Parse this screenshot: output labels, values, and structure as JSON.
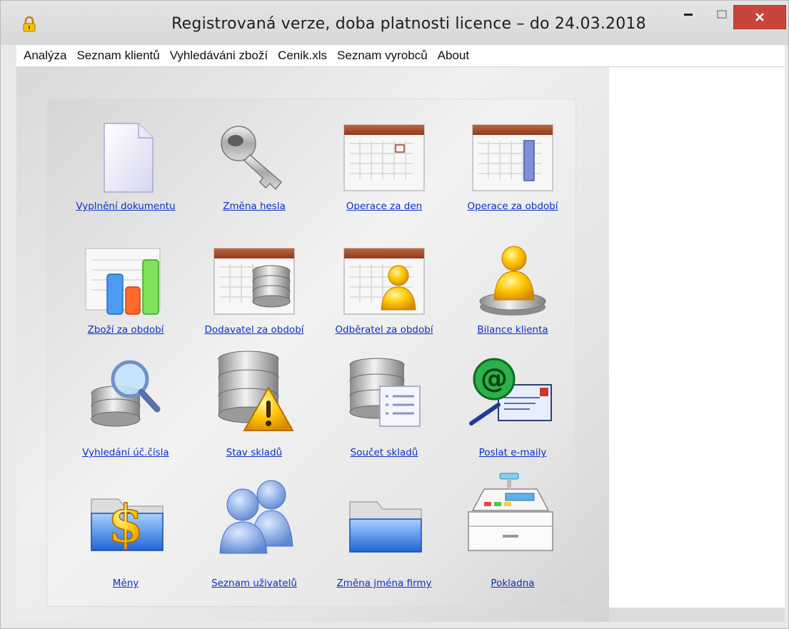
{
  "window": {
    "title": "Registrovaná verze, doba platnosti licence – do  24.03.2018",
    "controls": {
      "minimize": "–",
      "maximize": "☐",
      "close": "✕"
    }
  },
  "menu": {
    "items": [
      "Analýza",
      "Seznam klientů",
      "Vyhledáváni zboží",
      "Cenik.xls",
      "Seznam vyrobců",
      "About"
    ]
  },
  "tiles": [
    {
      "label": "Vyplnění dokumentu",
      "icon": "document-icon"
    },
    {
      "label": "Změna hesla",
      "icon": "key-icon"
    },
    {
      "label": "Operace za den",
      "icon": "calendar-day-icon"
    },
    {
      "label": "Operace za období",
      "icon": "calendar-period-icon"
    },
    {
      "label": "Zboží za období",
      "icon": "bar-chart-icon"
    },
    {
      "label": "Dodavatel za období",
      "icon": "calendar-database-icon"
    },
    {
      "label": "Odběratel za období",
      "icon": "calendar-user-icon"
    },
    {
      "label": "Bilance klienta",
      "icon": "user-pedestal-icon"
    },
    {
      "label": "Vyhledání úč.čísla",
      "icon": "database-search-icon"
    },
    {
      "label": "Stav skladů",
      "icon": "database-warning-icon"
    },
    {
      "label": "Součet skladů",
      "icon": "database-list-icon"
    },
    {
      "label": "Poslat e-maily",
      "icon": "email-icon"
    },
    {
      "label": "Měny",
      "icon": "dollar-folder-icon"
    },
    {
      "label": "Seznam uživatelů",
      "icon": "users-icon"
    },
    {
      "label": "Změna jména firmy",
      "icon": "folder-icon"
    },
    {
      "label": "Pokladna",
      "icon": "cash-register-icon"
    }
  ],
  "colors": {
    "link": "#0a2fc8",
    "close_button": "#c7453a"
  }
}
